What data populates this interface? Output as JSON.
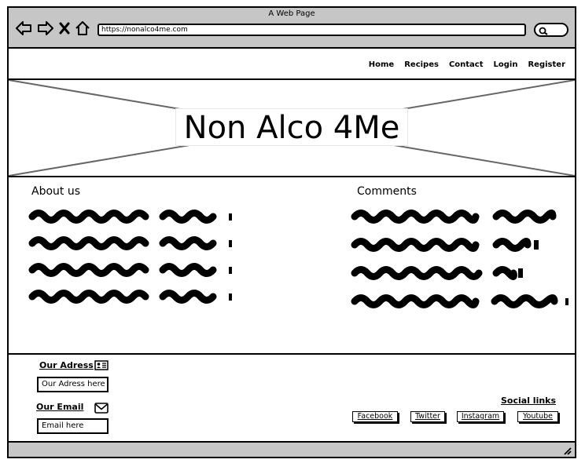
{
  "window": {
    "title": "A Web Page"
  },
  "browser": {
    "url": "https://nonalco4me.com"
  },
  "nav": {
    "items": [
      "Home",
      "Recipes",
      "Contact",
      "Login",
      "Register"
    ]
  },
  "hero": {
    "title": "Non Alco 4Me"
  },
  "sections": {
    "about_title": "About us",
    "comments_title": "Comments"
  },
  "footer": {
    "address_label": "Our Adress",
    "address_value": "Our Adress here",
    "email_label": "Our Email",
    "email_value": "Email here",
    "social_title": "Social links",
    "social": [
      "Facebook",
      "Twitter",
      "Instagram",
      "Youtube"
    ]
  }
}
